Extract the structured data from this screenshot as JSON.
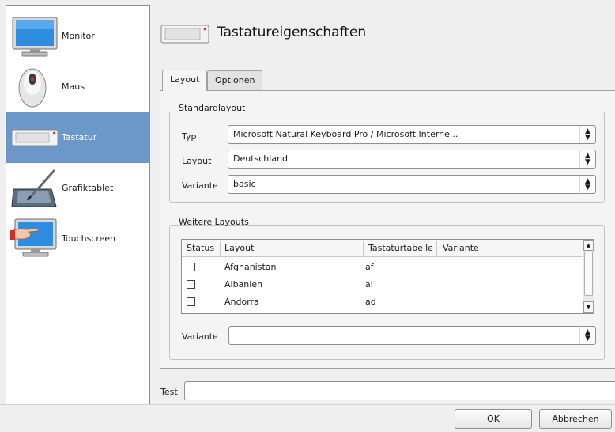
{
  "sidebar": {
    "items": [
      {
        "label": "Monitor",
        "icon": "monitor-icon",
        "selected": false
      },
      {
        "label": "Maus",
        "icon": "mouse-icon",
        "selected": false
      },
      {
        "label": "Tastatur",
        "icon": "keyboard-icon",
        "selected": true
      },
      {
        "label": "Grafiktablet",
        "icon": "graphics-tablet-icon",
        "selected": false
      },
      {
        "label": "Touchscreen",
        "icon": "touchscreen-icon",
        "selected": false
      }
    ]
  },
  "header": {
    "title": "Tastatureigenschaften",
    "icon": "keyboard-icon"
  },
  "tabs": [
    {
      "label": "Layout",
      "active": true
    },
    {
      "label": "Optionen",
      "active": false
    }
  ],
  "standard": {
    "title": "Standardlayout",
    "typ_label": "Typ",
    "typ_value": "Microsoft Natural Keyboard Pro / Microsoft Interne...",
    "layout_label": "Layout",
    "layout_value": "Deutschland",
    "variante_label": "Variante",
    "variante_value": "basic"
  },
  "weitere": {
    "title": "Weitere Layouts",
    "columns": [
      "Status",
      "Layout",
      "Tastaturtabelle",
      "Variante"
    ],
    "rows": [
      {
        "layout": "Afghanistan",
        "table": "af",
        "variant": "",
        "checked": false
      },
      {
        "layout": "Albanien",
        "table": "al",
        "variant": "",
        "checked": false
      },
      {
        "layout": "Andorra",
        "table": "ad",
        "variant": "",
        "checked": false
      }
    ],
    "variante_label": "Variante",
    "variante_value": ""
  },
  "test": {
    "label": "Test",
    "value": ""
  },
  "buttons": {
    "ok": {
      "prefix": "O",
      "mnemonic": "K",
      "suffix": ""
    },
    "cancel": {
      "prefix": "",
      "mnemonic": "A",
      "suffix": "bbrechen"
    }
  },
  "colors": {
    "selection": "#6b97c9",
    "background": "#efefef"
  }
}
